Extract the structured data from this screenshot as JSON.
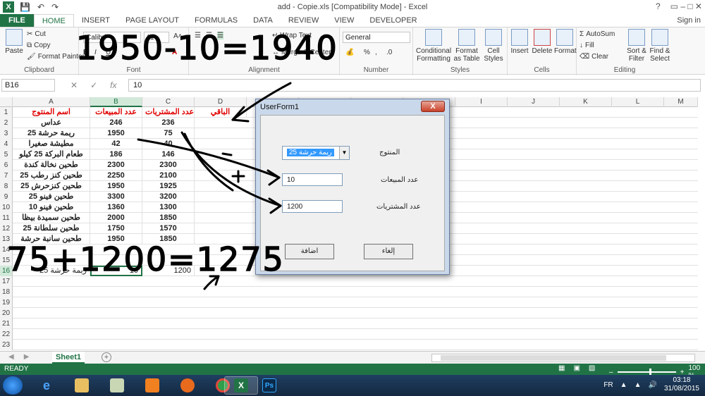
{
  "titlebar": {
    "title": "add - Copie.xls  [Compatibility Mode] - Excel",
    "logo": "X",
    "help": "?",
    "winctl": "▭  –  □  ✕"
  },
  "tabs": [
    "HOME",
    "INSERT",
    "PAGE LAYOUT",
    "FORMULAS",
    "DATA",
    "REVIEW",
    "VIEW",
    "DEVELOPER"
  ],
  "file_tab": "FILE",
  "signin": "Sign in",
  "ribbon": {
    "paste": "Paste",
    "cut": "Cut",
    "copy": "Copy",
    "format_painter": "Format Painter",
    "clipboard": "Clipboard",
    "font_name": "Calibri",
    "font_size": "11",
    "font": "Font",
    "wrap_text": "Wrap Text",
    "merge_center": "Merge & Center",
    "alignment": "Alignment",
    "number_format": "General",
    "number": "Number",
    "conditional_formatting": "Conditional Formatting",
    "format_as_table": "Format as Table",
    "cell_styles": "Cell Styles",
    "styles": "Styles",
    "insert": "Insert",
    "delete": "Delete",
    "format": "Format",
    "cells": "Cells",
    "autosum": "AutoSum",
    "fill": "Fill",
    "clear": "Clear",
    "sort_filter": "Sort & Filter",
    "find_select": "Find & Select",
    "editing": "Editing"
  },
  "formula_bar": {
    "name_box": "B16",
    "fx": "fx",
    "value": "10"
  },
  "columns": [
    "A",
    "B",
    "C",
    "D",
    "E",
    "F",
    "G",
    "H",
    "I",
    "J",
    "K",
    "L",
    "M"
  ],
  "header_row": {
    "a": "اسم المنتوج",
    "b": "عدد المبيعات",
    "c": "عدد المشتريات",
    "d": "الباقي"
  },
  "rows": [
    {
      "a": "عداس",
      "b": "246",
      "c": "236"
    },
    {
      "a": "ريمة حرشة 25",
      "b": "1950",
      "c": "75"
    },
    {
      "a": "مطيشة صغيرا",
      "b": "42",
      "c": "40"
    },
    {
      "a": "طعام البركة 25 كيلو",
      "b": "186",
      "c": "146"
    },
    {
      "a": "طحين نخالة كندة",
      "b": "2300",
      "c": "2300"
    },
    {
      "a": "طحين كنز رطب 25",
      "b": "2250",
      "c": "2100"
    },
    {
      "a": "طحين كنزحرش 25",
      "b": "1950",
      "c": "1925"
    },
    {
      "a": "طحين فينو 25",
      "b": "3300",
      "c": "3200"
    },
    {
      "a": "طحين فينو 10",
      "b": "1360",
      "c": "1300"
    },
    {
      "a": "طحين سميدة بيظا",
      "b": "2000",
      "c": "1850"
    },
    {
      "a": "طحين سلطانة 25",
      "b": "1750",
      "c": "1570"
    },
    {
      "a": "طحين سانبة حرشة",
      "b": "1950",
      "c": "1850"
    }
  ],
  "row16": {
    "a": "ريمة حرشة 25",
    "b": "10",
    "c": "1200"
  },
  "row_numbers": [
    "1",
    "2",
    "3",
    "4",
    "5",
    "6",
    "7",
    "8",
    "9",
    "10",
    "11",
    "12",
    "13",
    "14",
    "15",
    "16",
    "17",
    "18",
    "19",
    "20",
    "21",
    "22",
    "23"
  ],
  "sheet": {
    "name": "Sheet1",
    "add": "+"
  },
  "status": {
    "ready": "READY",
    "zoom": "100 %"
  },
  "userform": {
    "title": "UserForm1",
    "close": "X",
    "product_label": "المنتوج",
    "product_value": "ريمة حرشة 25",
    "sales_label": "عدد المبيعات",
    "sales_value": "10",
    "purchases_label": "عدد المشتريات",
    "purchases_value": "1200",
    "add_button": "اضافة",
    "cancel_button": "إلغاء"
  },
  "taskbar": {
    "lang": "FR",
    "time": "03:18",
    "date": "31/08/2015",
    "excel": "X",
    "photoshop": "Ps"
  },
  "handwriting": {
    "line1": "1950-10=1940",
    "line2": "75+1200=1275"
  }
}
